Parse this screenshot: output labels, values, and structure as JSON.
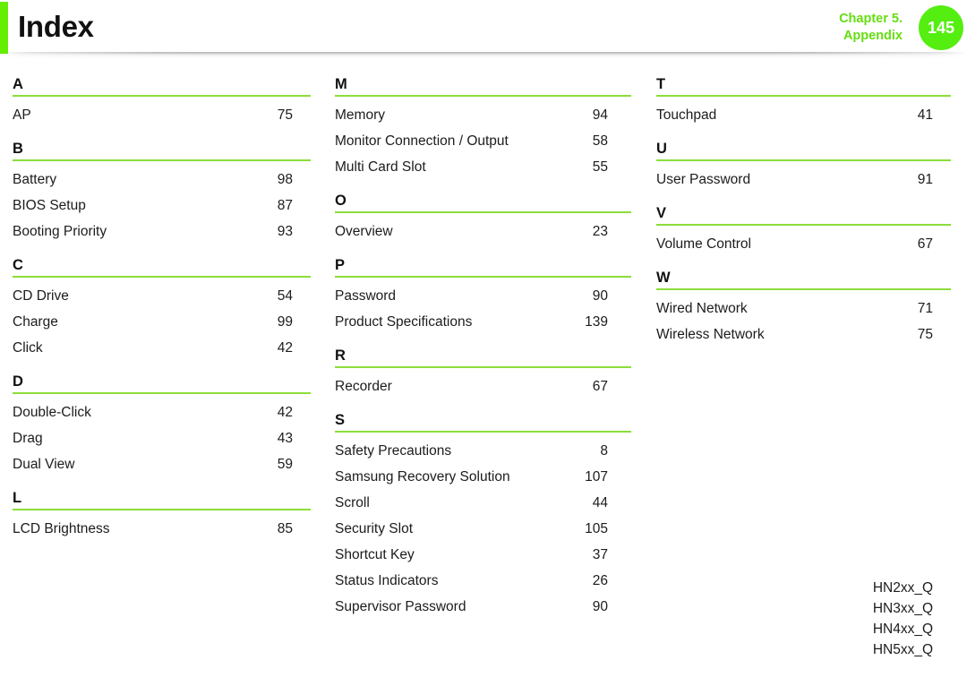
{
  "header": {
    "title": "Index",
    "chapter_line1": "Chapter 5.",
    "chapter_line2": "Appendix",
    "page_number": "145",
    "accent_color": "#66ee00",
    "badge_color": "#55ee11",
    "rule_color": "#8cdd3a"
  },
  "columns": [
    {
      "id": "column-1",
      "groups": [
        {
          "letter": "A",
          "entries": [
            {
              "title": "AP",
              "page": "75"
            }
          ]
        },
        {
          "letter": "B",
          "entries": [
            {
              "title": "Battery",
              "page": "98"
            },
            {
              "title": "BIOS Setup",
              "page": "87"
            },
            {
              "title": "Booting Priority",
              "page": "93"
            }
          ]
        },
        {
          "letter": "C",
          "entries": [
            {
              "title": "CD Drive",
              "page": "54"
            },
            {
              "title": "Charge",
              "page": "99"
            },
            {
              "title": "Click",
              "page": "42"
            }
          ]
        },
        {
          "letter": "D",
          "entries": [
            {
              "title": "Double-Click",
              "page": "42"
            },
            {
              "title": "Drag",
              "page": "43"
            },
            {
              "title": "Dual View",
              "page": "59"
            }
          ]
        },
        {
          "letter": "L",
          "entries": [
            {
              "title": "LCD Brightness",
              "page": "85"
            }
          ]
        }
      ]
    },
    {
      "id": "column-2",
      "groups": [
        {
          "letter": "M",
          "entries": [
            {
              "title": "Memory",
              "page": "94"
            },
            {
              "title": "Monitor Connection / Output",
              "page": "58"
            },
            {
              "title": "Multi Card Slot",
              "page": "55"
            }
          ]
        },
        {
          "letter": "O",
          "entries": [
            {
              "title": "Overview",
              "page": "23"
            }
          ]
        },
        {
          "letter": "P",
          "entries": [
            {
              "title": "Password",
              "page": "90"
            },
            {
              "title": "Product Specifications",
              "page": "139"
            }
          ]
        },
        {
          "letter": "R",
          "entries": [
            {
              "title": "Recorder",
              "page": "67"
            }
          ]
        },
        {
          "letter": "S",
          "entries": [
            {
              "title": "Safety Precautions",
              "page": "8"
            },
            {
              "title": "Samsung Recovery Solution",
              "page": "107"
            },
            {
              "title": "Scroll",
              "page": "44"
            },
            {
              "title": "Security Slot",
              "page": "105"
            },
            {
              "title": "Shortcut Key",
              "page": "37"
            },
            {
              "title": "Status Indicators",
              "page": "26"
            },
            {
              "title": "Supervisor Password",
              "page": "90"
            }
          ]
        }
      ]
    },
    {
      "id": "column-3",
      "groups": [
        {
          "letter": "T",
          "entries": [
            {
              "title": "Touchpad",
              "page": "41"
            }
          ]
        },
        {
          "letter": "U",
          "entries": [
            {
              "title": "User Password",
              "page": "91"
            }
          ]
        },
        {
          "letter": "V",
          "entries": [
            {
              "title": "Volume Control",
              "page": "67"
            }
          ]
        },
        {
          "letter": "W",
          "entries": [
            {
              "title": "Wired Network",
              "page": "71"
            },
            {
              "title": "Wireless Network",
              "page": "75"
            }
          ]
        }
      ]
    }
  ],
  "model_numbers": [
    "HN2xx_Q",
    "HN3xx_Q",
    "HN4xx_Q",
    "HN5xx_Q"
  ]
}
